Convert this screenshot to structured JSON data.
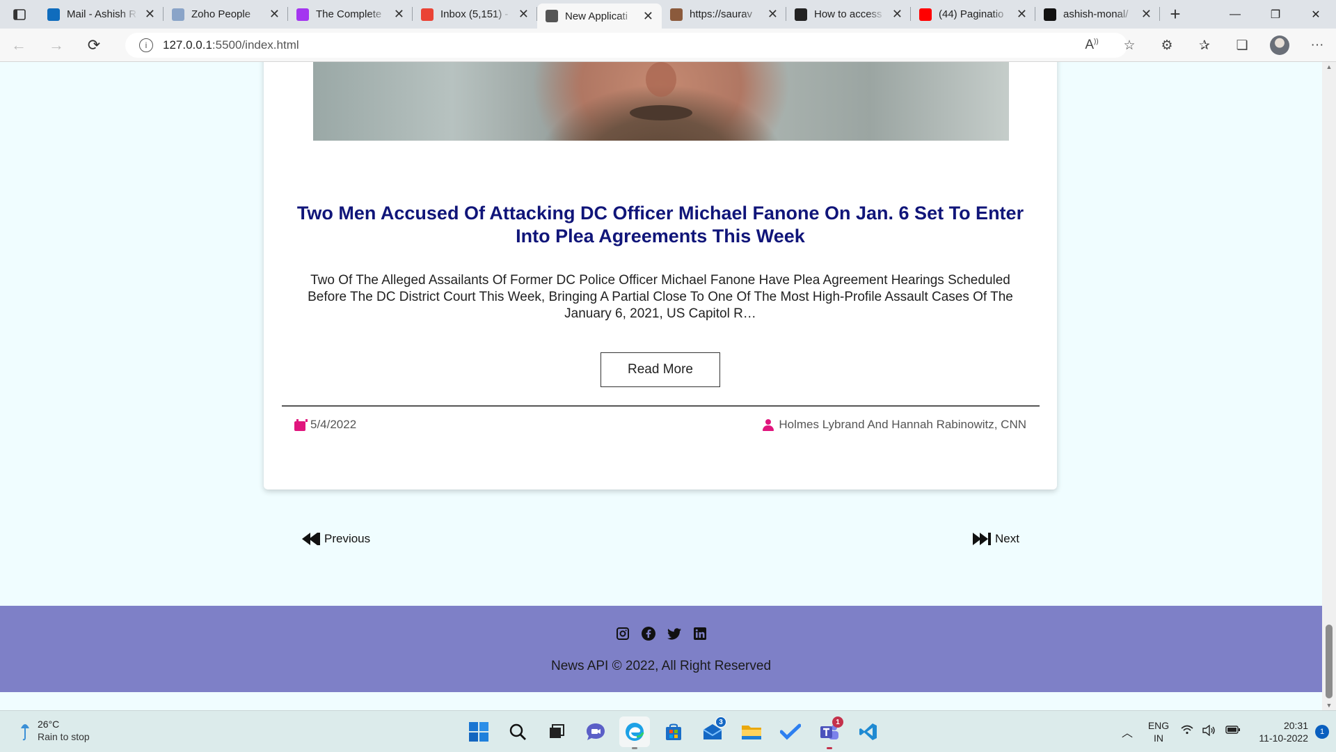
{
  "browser": {
    "tabs": [
      {
        "title": "Mail - Ashish R",
        "favicon": "outlook-icon",
        "color": "#0f6cbd"
      },
      {
        "title": "Zoho People",
        "favicon": "zoho-icon",
        "color": "#8aa4c8"
      },
      {
        "title": "The Complete",
        "favicon": "udemy-icon",
        "color": "#a435f0"
      },
      {
        "title": "Inbox (5,151) -",
        "favicon": "gmail-icon",
        "color": "#ea4335"
      },
      {
        "title": "New Applicati",
        "favicon": "document-icon",
        "color": "#555555",
        "active": true
      },
      {
        "title": "https://saurav",
        "favicon": "avatar-icon",
        "color": "#8b5a3c"
      },
      {
        "title": "How to access",
        "favicon": "eh-icon",
        "color": "#222222"
      },
      {
        "title": "(44) Paginatio",
        "favicon": "youtube-icon",
        "color": "#ff0000"
      },
      {
        "title": "ashish-monal/",
        "favicon": "github-icon",
        "color": "#111111"
      }
    ],
    "url_host": "127.0.0.1",
    "url_path": ":5500/index.html"
  },
  "article": {
    "title": "Two Men Accused Of Attacking DC Officer Michael Fanone On Jan. 6 Set To Enter Into Plea Agreements This Week",
    "description": "Two Of The Alleged Assailants Of Former DC Police Officer Michael Fanone Have Plea Agreement Hearings Scheduled Before The DC District Court This Week, Bringing A Partial Close To One Of The Most High-Profile Assault Cases Of The January 6, 2021, US Capitol R…",
    "read_more_label": "Read More",
    "date": "5/4/2022",
    "author": "Holmes Lybrand And Hannah Rabinowitz, CNN"
  },
  "pagination": {
    "previous_label": "Previous",
    "next_label": "Next"
  },
  "footer": {
    "social": [
      "instagram-icon",
      "facebook-icon",
      "twitter-icon",
      "linkedin-icon"
    ],
    "copyright": "News API © 2022, All Right Reserved",
    "background": "#7e80c7"
  },
  "colors": {
    "title": "#101579",
    "accent_icon": "#e0157d",
    "page_bg": "#f0fdff"
  },
  "taskbar": {
    "temperature": "26°C",
    "weather": "Rain to stop",
    "lang_top": "ENG",
    "lang_bottom": "IN",
    "time": "20:31",
    "date": "11-10-2022",
    "notification_count": "1",
    "mail_badge": "3",
    "teams_badge": "1"
  }
}
